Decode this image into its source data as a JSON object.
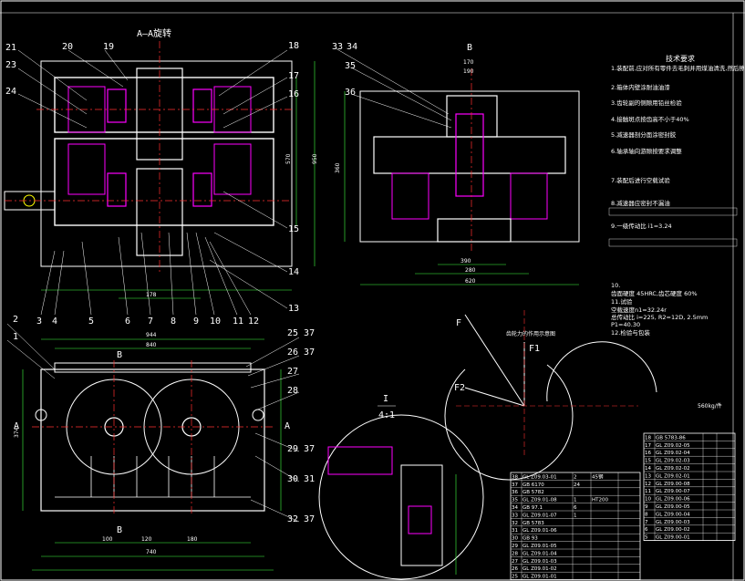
{
  "section_label": "A—A旋转",
  "view_b_label": "B",
  "view_b_mark_bottom": "B",
  "arrow_a_left": "A",
  "arrow_a_right": "A",
  "detail_label": "I",
  "detail_scale": "4:1",
  "force_diagram_title": "齿轮力的作用示意图",
  "force_labels": {
    "f": "F",
    "f1": "F1",
    "f2": "F2"
  },
  "weight_note": "560kg/件",
  "tech_requirements": {
    "title": "技术要求",
    "lines": [
      "1.装配前,应对所有零件去毛刺并用煤油清洗,然后擦干",
      "2.箱体内壁涂耐油油漆",
      "3.齿轮副的侧隙用铅丝检验",
      "4.接触斑点按齿高不小于40%",
      "5.减速器剖分面涂密封胶",
      "6.轴承轴向游隙按要求调整",
      "7.装配后进行空载试验",
      "8.减速器应密封不漏油",
      "9.一级传动比 i1=3.24",
      "10.",
      "齿面硬度 45HRC,齿芯硬度 60%",
      "11.试验",
      "空载速度n1=32.24r",
      "总传动比 i=225, R2=12D, 2.5mm",
      "P1=40.30",
      "12.检验与包装"
    ]
  },
  "part_numbers_left": [
    "21",
    "23",
    "24",
    "2",
    "1"
  ],
  "part_numbers_top": [
    "20",
    "19"
  ],
  "part_numbers_right": [
    "18",
    "17",
    "16",
    "15",
    "14",
    "13"
  ],
  "part_numbers_bottom": [
    "3",
    "4",
    "5",
    "6",
    "7",
    "8",
    "9",
    "10",
    "11",
    "12"
  ],
  "part_numbers_side": [
    "33",
    "34",
    "35",
    "36"
  ],
  "part_numbers_front_right": [
    "25 37",
    "26 37",
    "27",
    "28",
    "29 37",
    "30 31",
    "32 37"
  ],
  "dims": {
    "a1": "950",
    "a2": "944",
    "a3": "840",
    "a4": "570",
    "a5": "740",
    "a6": "374",
    "b1": "390",
    "b2": "170",
    "b3": "190",
    "b4": "150",
    "b5": "360",
    "b6": "280",
    "b7": "620",
    "c1": "320",
    "c2": "100",
    "c3": "120",
    "c4": "180",
    "c5": "250",
    "c6": "178"
  },
  "parts_table": {
    "rows_left": [
      [
        "38",
        "GL Z09.03-01",
        "2",
        "45钢",
        ""
      ],
      [
        "37",
        "GB 6170",
        "24",
        "",
        ""
      ],
      [
        "36",
        "GB 5782",
        "",
        "",
        ""
      ],
      [
        "35",
        "GL Z09.01-08",
        "1",
        "HT200",
        ""
      ],
      [
        "34",
        "GB 97.1",
        "6",
        "",
        ""
      ],
      [
        "33",
        "GL Z09.01-07",
        "1",
        "",
        ""
      ],
      [
        "32",
        "GB 5783",
        "",
        "",
        ""
      ],
      [
        "31",
        "GL Z09.01-06",
        "",
        "",
        ""
      ],
      [
        "30",
        "GB 93",
        "",
        "",
        ""
      ],
      [
        "29",
        "GL Z09.01-05",
        "",
        "",
        ""
      ],
      [
        "28",
        "GL Z09.01-04",
        "",
        "",
        ""
      ],
      [
        "27",
        "GL Z09.01-03",
        "",
        "",
        ""
      ],
      [
        "26",
        "GL Z09.01-02",
        "",
        "",
        ""
      ],
      [
        "25",
        "GL Z09.01-01",
        "",
        "",
        ""
      ]
    ],
    "rows_right": [
      [
        "18",
        "GB 5783-86",
        "",
        ""
      ],
      [
        "17",
        "GL Z09.02-05",
        "",
        ""
      ],
      [
        "16",
        "GL Z09.02-04",
        "",
        ""
      ],
      [
        "15",
        "GL Z09.02-03",
        "",
        ""
      ],
      [
        "14",
        "GL Z09.02-02",
        "",
        ""
      ],
      [
        "13",
        "GL Z09.02-01",
        "",
        ""
      ],
      [
        "12",
        "GL Z09.00-08",
        "",
        ""
      ],
      [
        "11",
        "GL Z09.00-07",
        "",
        ""
      ],
      [
        "10",
        "GL Z09.00-06",
        "",
        ""
      ],
      [
        "9",
        "GL Z09.00-05",
        "",
        ""
      ],
      [
        "8",
        "GL Z09.00-04",
        "",
        ""
      ],
      [
        "7",
        "GL Z09.00-03",
        "",
        ""
      ],
      [
        "6",
        "GL Z09.00-02",
        "",
        ""
      ],
      [
        "5",
        "GL Z09.00-01",
        "",
        ""
      ]
    ]
  },
  "colors": {
    "bg": "#000000",
    "outline": "#ffffff",
    "hatch": "#ff00ff",
    "center": "#ff3030",
    "dimension": "#40ff40",
    "leader": "#ffffff",
    "accent": "#00ffff",
    "yellow": "#ffff00",
    "blue": "#4060ff"
  }
}
